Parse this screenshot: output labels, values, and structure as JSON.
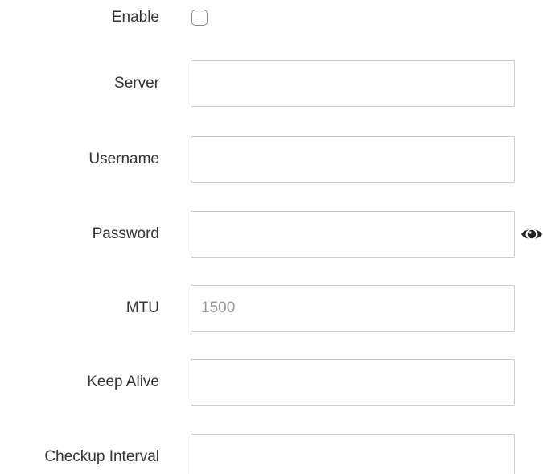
{
  "form": {
    "enable": {
      "label": "Enable",
      "checked": false
    },
    "server": {
      "label": "Server",
      "value": "",
      "placeholder": ""
    },
    "username": {
      "label": "Username",
      "value": "",
      "placeholder": ""
    },
    "password": {
      "label": "Password",
      "value": "",
      "placeholder": "",
      "reveal_icon": "eye-icon"
    },
    "mtu": {
      "label": "MTU",
      "value": "",
      "placeholder": "1500"
    },
    "keep_alive": {
      "label": "Keep Alive",
      "value": "",
      "placeholder": ""
    },
    "checkup_interval": {
      "label": "Checkup Interval",
      "value": "",
      "placeholder": ""
    }
  },
  "colors": {
    "text": "#333333",
    "input_border": "#cccccc",
    "placeholder": "#999999",
    "checkbox_border": "#8a8a8a"
  }
}
